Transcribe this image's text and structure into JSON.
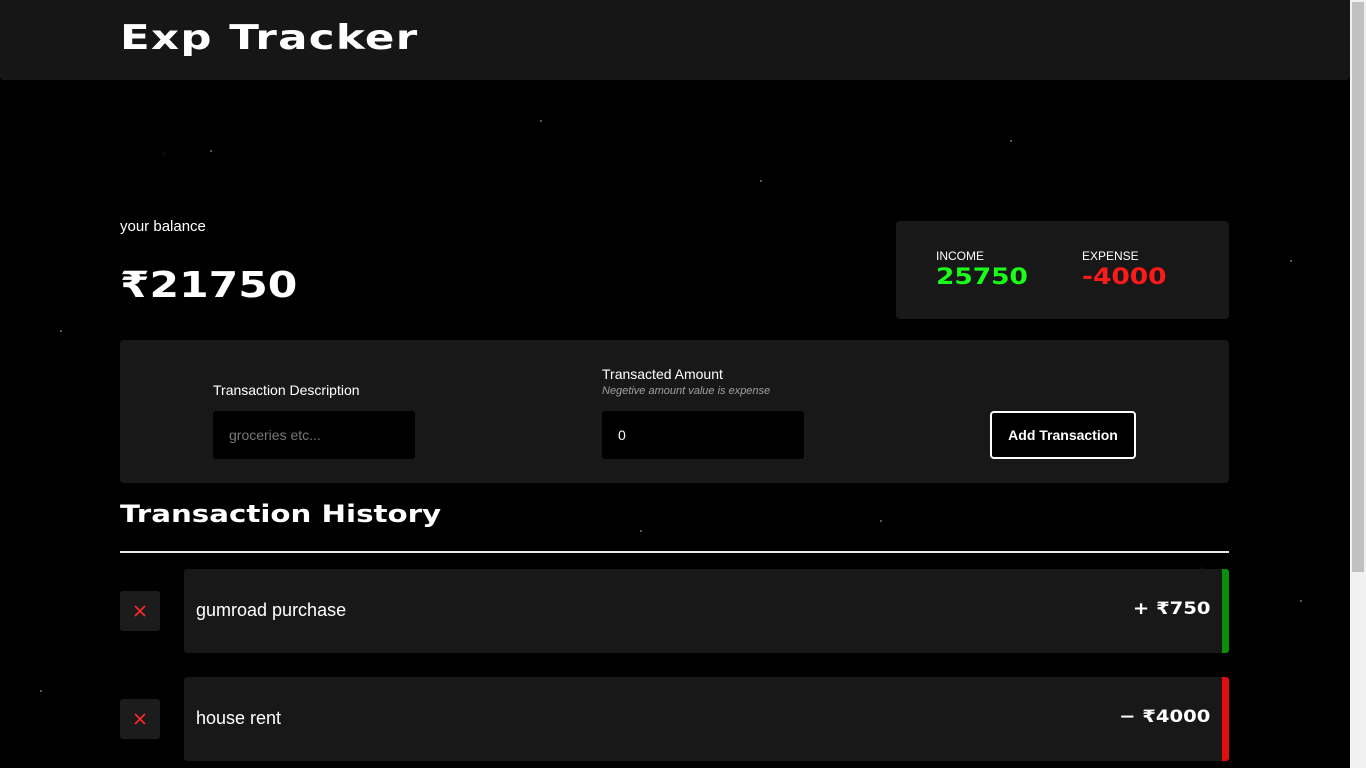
{
  "app": {
    "title": "Exp Tracker"
  },
  "balance": {
    "label": "your balance",
    "value": "₹21750"
  },
  "summary": {
    "income_label": "INCOME",
    "income_value": "25750",
    "expense_label": "EXPENSE",
    "expense_value": "-4000"
  },
  "form": {
    "description_label": "Transaction Description",
    "description_placeholder": "groceries etc...",
    "description_value": "",
    "amount_label": "Transacted Amount",
    "amount_hint": "Negetive amount value is expense",
    "amount_value": "0",
    "submit_label": "Add Transaction"
  },
  "history": {
    "title": "Transaction History",
    "transactions": [
      {
        "description": "gumroad purchase",
        "amount": "+ ₹750",
        "type": "income"
      },
      {
        "description": "house rent",
        "amount": "− ₹4000",
        "type": "expense"
      }
    ]
  },
  "colors": {
    "income": "#1aff1a",
    "expense": "#ff1a1a",
    "income_bar": "#0a8f0a",
    "expense_bar": "#e30d0d",
    "delete_icon": "#ff2a2a"
  },
  "icons": {
    "delete": "close-icon"
  }
}
